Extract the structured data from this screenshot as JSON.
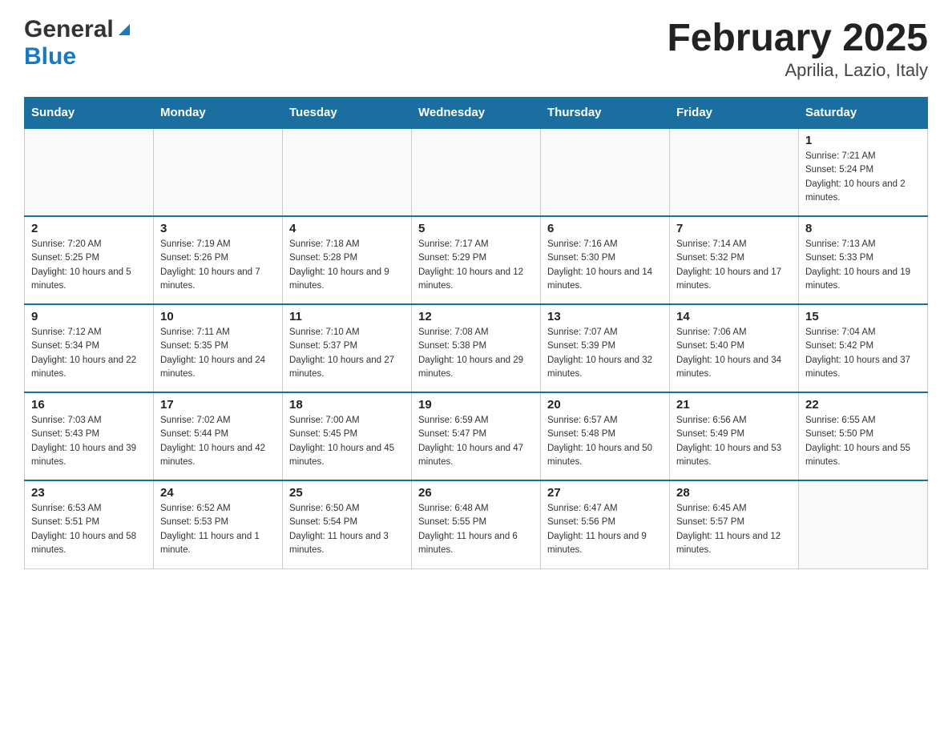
{
  "header": {
    "logo_general": "General",
    "logo_blue": "Blue",
    "month_title": "February 2025",
    "location": "Aprilia, Lazio, Italy"
  },
  "weekdays": [
    "Sunday",
    "Monday",
    "Tuesday",
    "Wednesday",
    "Thursday",
    "Friday",
    "Saturday"
  ],
  "weeks": [
    [
      {
        "day": "",
        "info": ""
      },
      {
        "day": "",
        "info": ""
      },
      {
        "day": "",
        "info": ""
      },
      {
        "day": "",
        "info": ""
      },
      {
        "day": "",
        "info": ""
      },
      {
        "day": "",
        "info": ""
      },
      {
        "day": "1",
        "info": "Sunrise: 7:21 AM\nSunset: 5:24 PM\nDaylight: 10 hours and 2 minutes."
      }
    ],
    [
      {
        "day": "2",
        "info": "Sunrise: 7:20 AM\nSunset: 5:25 PM\nDaylight: 10 hours and 5 minutes."
      },
      {
        "day": "3",
        "info": "Sunrise: 7:19 AM\nSunset: 5:26 PM\nDaylight: 10 hours and 7 minutes."
      },
      {
        "day": "4",
        "info": "Sunrise: 7:18 AM\nSunset: 5:28 PM\nDaylight: 10 hours and 9 minutes."
      },
      {
        "day": "5",
        "info": "Sunrise: 7:17 AM\nSunset: 5:29 PM\nDaylight: 10 hours and 12 minutes."
      },
      {
        "day": "6",
        "info": "Sunrise: 7:16 AM\nSunset: 5:30 PM\nDaylight: 10 hours and 14 minutes."
      },
      {
        "day": "7",
        "info": "Sunrise: 7:14 AM\nSunset: 5:32 PM\nDaylight: 10 hours and 17 minutes."
      },
      {
        "day": "8",
        "info": "Sunrise: 7:13 AM\nSunset: 5:33 PM\nDaylight: 10 hours and 19 minutes."
      }
    ],
    [
      {
        "day": "9",
        "info": "Sunrise: 7:12 AM\nSunset: 5:34 PM\nDaylight: 10 hours and 22 minutes."
      },
      {
        "day": "10",
        "info": "Sunrise: 7:11 AM\nSunset: 5:35 PM\nDaylight: 10 hours and 24 minutes."
      },
      {
        "day": "11",
        "info": "Sunrise: 7:10 AM\nSunset: 5:37 PM\nDaylight: 10 hours and 27 minutes."
      },
      {
        "day": "12",
        "info": "Sunrise: 7:08 AM\nSunset: 5:38 PM\nDaylight: 10 hours and 29 minutes."
      },
      {
        "day": "13",
        "info": "Sunrise: 7:07 AM\nSunset: 5:39 PM\nDaylight: 10 hours and 32 minutes."
      },
      {
        "day": "14",
        "info": "Sunrise: 7:06 AM\nSunset: 5:40 PM\nDaylight: 10 hours and 34 minutes."
      },
      {
        "day": "15",
        "info": "Sunrise: 7:04 AM\nSunset: 5:42 PM\nDaylight: 10 hours and 37 minutes."
      }
    ],
    [
      {
        "day": "16",
        "info": "Sunrise: 7:03 AM\nSunset: 5:43 PM\nDaylight: 10 hours and 39 minutes."
      },
      {
        "day": "17",
        "info": "Sunrise: 7:02 AM\nSunset: 5:44 PM\nDaylight: 10 hours and 42 minutes."
      },
      {
        "day": "18",
        "info": "Sunrise: 7:00 AM\nSunset: 5:45 PM\nDaylight: 10 hours and 45 minutes."
      },
      {
        "day": "19",
        "info": "Sunrise: 6:59 AM\nSunset: 5:47 PM\nDaylight: 10 hours and 47 minutes."
      },
      {
        "day": "20",
        "info": "Sunrise: 6:57 AM\nSunset: 5:48 PM\nDaylight: 10 hours and 50 minutes."
      },
      {
        "day": "21",
        "info": "Sunrise: 6:56 AM\nSunset: 5:49 PM\nDaylight: 10 hours and 53 minutes."
      },
      {
        "day": "22",
        "info": "Sunrise: 6:55 AM\nSunset: 5:50 PM\nDaylight: 10 hours and 55 minutes."
      }
    ],
    [
      {
        "day": "23",
        "info": "Sunrise: 6:53 AM\nSunset: 5:51 PM\nDaylight: 10 hours and 58 minutes."
      },
      {
        "day": "24",
        "info": "Sunrise: 6:52 AM\nSunset: 5:53 PM\nDaylight: 11 hours and 1 minute."
      },
      {
        "day": "25",
        "info": "Sunrise: 6:50 AM\nSunset: 5:54 PM\nDaylight: 11 hours and 3 minutes."
      },
      {
        "day": "26",
        "info": "Sunrise: 6:48 AM\nSunset: 5:55 PM\nDaylight: 11 hours and 6 minutes."
      },
      {
        "day": "27",
        "info": "Sunrise: 6:47 AM\nSunset: 5:56 PM\nDaylight: 11 hours and 9 minutes."
      },
      {
        "day": "28",
        "info": "Sunrise: 6:45 AM\nSunset: 5:57 PM\nDaylight: 11 hours and 12 minutes."
      },
      {
        "day": "",
        "info": ""
      }
    ]
  ]
}
